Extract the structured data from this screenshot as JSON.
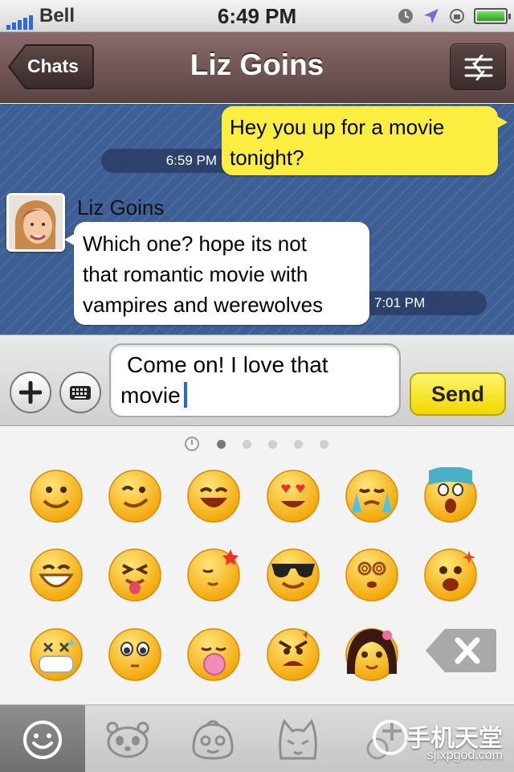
{
  "status_bar": {
    "carrier": "Bell",
    "time": "6:49 PM"
  },
  "nav": {
    "back_label": "Chats",
    "title": "Liz Goins"
  },
  "messages": [
    {
      "direction": "outgoing",
      "text_lines": [
        "Hey you up for a movie",
        "tonight?"
      ],
      "time": "6:59 PM"
    },
    {
      "direction": "incoming",
      "sender": "Liz Goins",
      "text_lines": [
        "Which one? hope its not",
        "that romantic movie with",
        "vampires and werewolves"
      ],
      "time": "7:01 PM"
    }
  ],
  "composer": {
    "text_lines": [
      "Come on! I love that",
      "movie"
    ],
    "send_label": "Send"
  },
  "emoji_panel": {
    "pages": 5,
    "active_page": 0,
    "emojis": [
      "smile-emoji",
      "wink-emoji",
      "laughing-emoji",
      "heart-eyes-emoji",
      "crying-emoji",
      "scared-emoji",
      "grin-emoji",
      "tongue-out-emoji",
      "sleepy-moon-emoji",
      "sunglasses-emoji",
      "dizzy-emoji",
      "excited-emoji",
      "sick-mask-emoji",
      "blush-emoji",
      "bubblegum-emoji",
      "angry-emoji",
      "girl-emoji"
    ]
  },
  "tabs": [
    "emoji-tab",
    "panda-tab",
    "bun-tab",
    "cat-tab",
    "add-tab"
  ],
  "watermark": {
    "title": "手机天堂",
    "url": "sj.xpgod.com"
  },
  "colors": {
    "nav_bar": "#6e5252",
    "chat_bg": "#3d5f96",
    "outgoing_bubble": "#fbee41",
    "incoming_bubble": "#ffffff",
    "send_button": "#f7e62a",
    "caret": "#2a64e0"
  }
}
